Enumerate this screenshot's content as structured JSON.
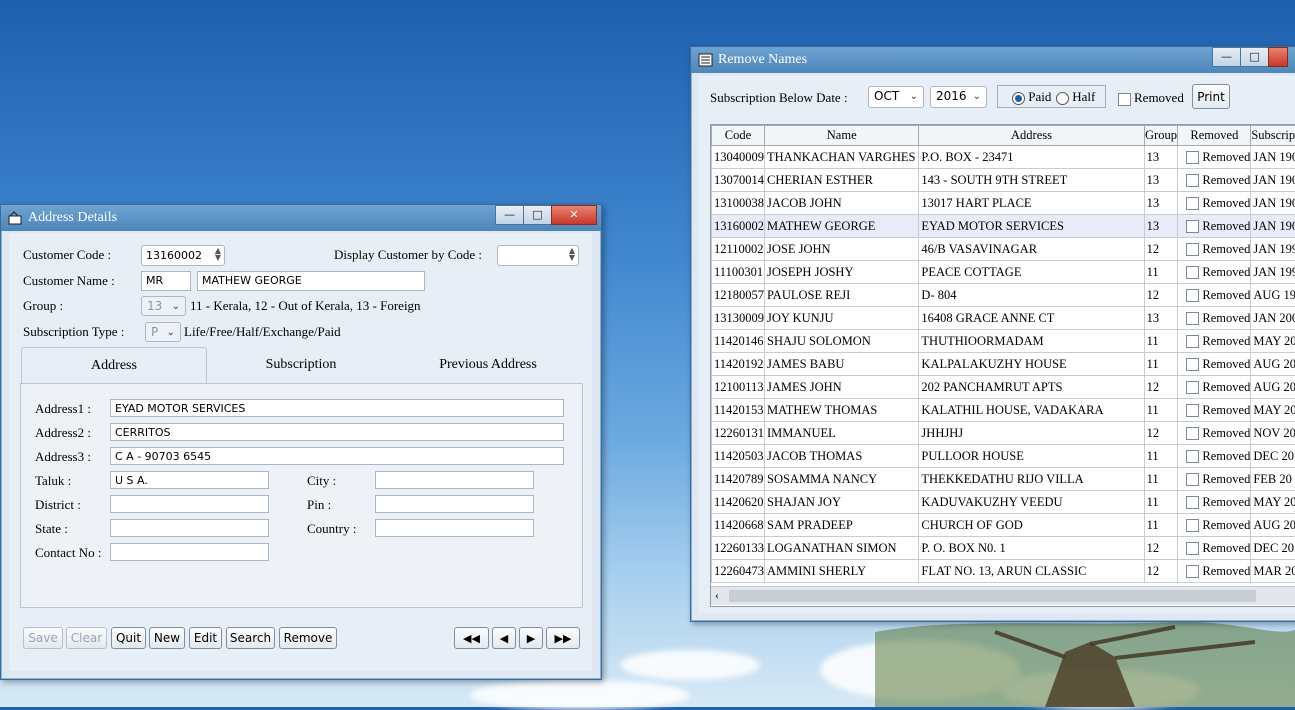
{
  "address_window": {
    "title": "Address Details",
    "customer_code_label": "Customer Code :",
    "customer_code": "13160002",
    "display_by_code_label": "Display Customer by Code :",
    "display_by_code_value": "",
    "customer_name_label": "Customer Name :",
    "name_prefix": "MR",
    "customer_name": "MATHEW GEORGE",
    "group_label": "Group :",
    "group_value": "13",
    "group_hint": "11 - Kerala, 12 - Out of Kerala, 13 - Foreign",
    "sub_type_label": "Subscription Type :",
    "sub_type_value": "P",
    "sub_type_hint": "Life/Free/Half/Exchange/Paid",
    "tabs": [
      "Address",
      "Subscription",
      "Previous Address"
    ],
    "address1_label": "Address1 :",
    "address1": "EYAD MOTOR SERVICES",
    "address2_label": "Address2 :",
    "address2": "CERRITOS",
    "address3_label": "Address3 :",
    "address3": "C A - 90703 6545",
    "taluk_label": "Taluk :",
    "taluk": "U S A.",
    "city_label": "City :",
    "city": "",
    "district_label": "District :",
    "district": "",
    "pin_label": "Pin :",
    "pin": "",
    "state_label": "State :",
    "state": "",
    "country_label": "Country :",
    "country": "",
    "contact_label": "Contact No :",
    "contact": "",
    "buttons": [
      "Save",
      "Clear",
      "Quit",
      "New",
      "Edit",
      "Search",
      "Remove"
    ],
    "nav": [
      "◀◀",
      "◀",
      "▶",
      "▶▶"
    ]
  },
  "remove_window": {
    "title": "Remove Names",
    "sub_below_label": "Subscription Below Date :",
    "month": "OCT",
    "year": "2016",
    "paid_label": "Paid",
    "half_label": "Half",
    "removed_label": "Removed",
    "print_label": "Print",
    "columns": [
      "Code",
      "Name",
      "Address",
      "Group",
      "Removed",
      "Subscrip"
    ],
    "rows": [
      [
        "13040009",
        "THANKACHAN VARGHES",
        "P.O. BOX - 23471",
        "13",
        "Removed",
        "JAN 190"
      ],
      [
        "13070014",
        "CHERIAN ESTHER",
        "143 - SOUTH 9TH STREET",
        "13",
        "Removed",
        "JAN 190"
      ],
      [
        "13100038",
        "JACOB JOHN",
        "13017 HART PLACE",
        "13",
        "Removed",
        "JAN 190"
      ],
      [
        "13160002",
        "MATHEW GEORGE",
        "EYAD MOTOR SERVICES",
        "13",
        "Removed",
        "JAN 190"
      ],
      [
        "12110002",
        "JOSE JOHN",
        "46/B VASAVINAGAR",
        "12",
        "Removed",
        "JAN 199"
      ],
      [
        "11100301",
        "JOSEPH JOSHY",
        "PEACE COTTAGE",
        "11",
        "Removed",
        "JAN 199"
      ],
      [
        "12180057",
        "PAULOSE REJI",
        "D- 804",
        "12",
        "Removed",
        "AUG 19"
      ],
      [
        "13130009",
        "JOY KUNJU",
        "16408 GRACE ANNE CT",
        "13",
        "Removed",
        "JAN 200"
      ],
      [
        "11420146",
        "SHAJU SOLOMON",
        "THUTHIOORMADAM",
        "11",
        "Removed",
        "MAY 20"
      ],
      [
        "11420192",
        "JAMES BABU",
        "KALPALAKUZHY HOUSE",
        "11",
        "Removed",
        "AUG 20"
      ],
      [
        "12100113",
        "JAMES JOHN",
        "202 PANCHAMRUT APTS",
        "12",
        "Removed",
        "AUG 20"
      ],
      [
        "11420153",
        "MATHEW THOMAS",
        "KALATHIL HOUSE, VADAKARA",
        "11",
        "Removed",
        "MAY 20"
      ],
      [
        "12260131",
        "IMMANUEL",
        "JHHJHJ",
        "12",
        "Removed",
        "NOV 20"
      ],
      [
        "11420503",
        "JACOB THOMAS",
        "PULLOOR HOUSE",
        "11",
        "Removed",
        "DEC 20"
      ],
      [
        "11420789",
        "SOSAMMA NANCY",
        "THEKKEDATHU RIJO VILLA",
        "11",
        "Removed",
        "FEB 20"
      ],
      [
        "11420620",
        "SHAJAN JOY",
        "KADUVAKUZHY VEEDU",
        "11",
        "Removed",
        "MAY 20"
      ],
      [
        "11420668",
        "SAM PRADEEP",
        "CHURCH OF GOD",
        "11",
        "Removed",
        "AUG 20"
      ],
      [
        "12260133",
        "LOGANATHAN SIMON",
        "P. O. BOX N0. 1",
        "12",
        "Removed",
        "DEC 20"
      ],
      [
        "12260473",
        "AMMINI SHERLY",
        "FLAT NO. 13, ARUN CLASSIC",
        "12",
        "Removed",
        "MAR 20"
      ]
    ],
    "selected_row": 3
  }
}
